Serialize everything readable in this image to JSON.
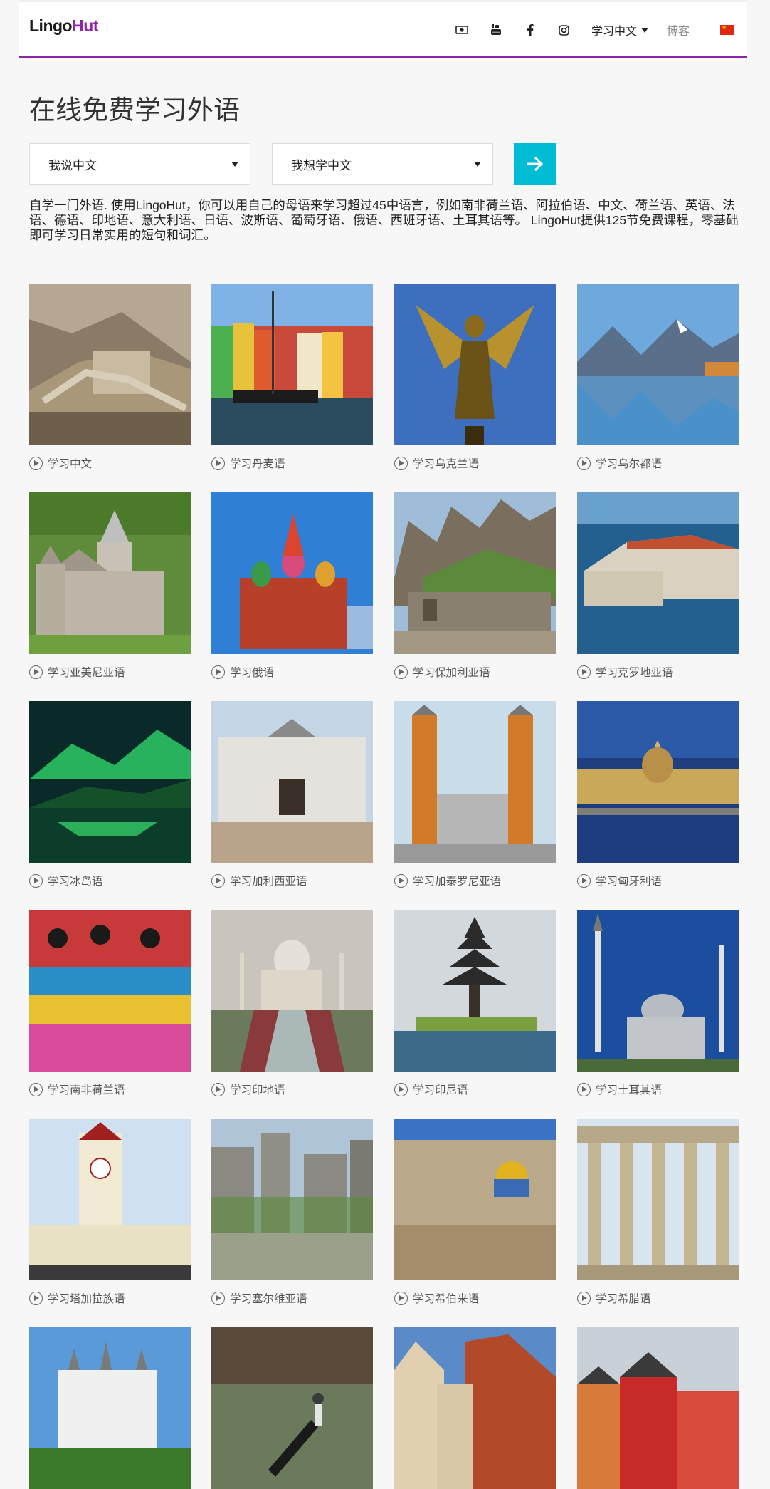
{
  "header": {
    "logo_part1": "Lingo",
    "logo_part2": "Hut",
    "icons": [
      "money-icon",
      "youtube-icon",
      "facebook-icon",
      "instagram-icon"
    ],
    "lang_menu_label": "学习中文",
    "blog_label": "博客",
    "flag_icon": "china-flag-icon",
    "accent_color": "#8e24aa"
  },
  "main": {
    "title": "在线免费学习外语",
    "speak_select": "我说中文",
    "learn_select": "我想学中文",
    "go_button_color": "#00bcd4",
    "intro": "自学一门外语. 使用LingoHut，你可以用自己的母语来学习超过45中语言，例如南非荷兰语、阿拉伯语、中文、荷兰语、英语、法语、德语、印地语、意大利语、日语、波斯语、葡萄牙语、俄语、西班牙语、土耳其语等。 LingoHut提供125节免费课程，零基础即可学习日常实用的短句和词汇。"
  },
  "courses": [
    {
      "label": "学习中文",
      "image": "great-wall"
    },
    {
      "label": "学习丹麦语",
      "image": "copenhagen-harbor"
    },
    {
      "label": "学习乌克兰语",
      "image": "golden-angel-statue"
    },
    {
      "label": "学习乌尔都语",
      "image": "mountain-lake"
    },
    {
      "label": "学习亚美尼亚语",
      "image": "armenian-monastery"
    },
    {
      "label": "学习俄语",
      "image": "st-basils-cathedral"
    },
    {
      "label": "学习保加利亚语",
      "image": "belogradchik-fortress"
    },
    {
      "label": "学习克罗地亚语",
      "image": "dubrovnik-walls"
    },
    {
      "label": "学习冰岛语",
      "image": "northern-lights"
    },
    {
      "label": "学习加利西亚语",
      "image": "galician-palace"
    },
    {
      "label": "学习加泰罗尼亚语",
      "image": "venetian-towers"
    },
    {
      "label": "学习匈牙利语",
      "image": "budapest-parliament"
    },
    {
      "label": "学习南非荷兰语",
      "image": "african-beadwork"
    },
    {
      "label": "学习印地语",
      "image": "taj-mahal"
    },
    {
      "label": "学习印尼语",
      "image": "bali-temple"
    },
    {
      "label": "学习土耳其语",
      "image": "blue-mosque"
    },
    {
      "label": "学习塔加拉族语",
      "image": "clock-tower"
    },
    {
      "label": "学习塞尔维亚语",
      "image": "golubac-fortress"
    },
    {
      "label": "学习希伯来语",
      "image": "jerusalem-dome"
    },
    {
      "label": "学习希腊语",
      "image": "temple-of-zeus"
    },
    {
      "label": "",
      "image": "neuschwanstein-castle"
    },
    {
      "label": "",
      "image": "venice-gondola"
    },
    {
      "label": "",
      "image": "riga-house-of-blackheads"
    },
    {
      "label": "",
      "image": "trondheim-houses"
    }
  ]
}
